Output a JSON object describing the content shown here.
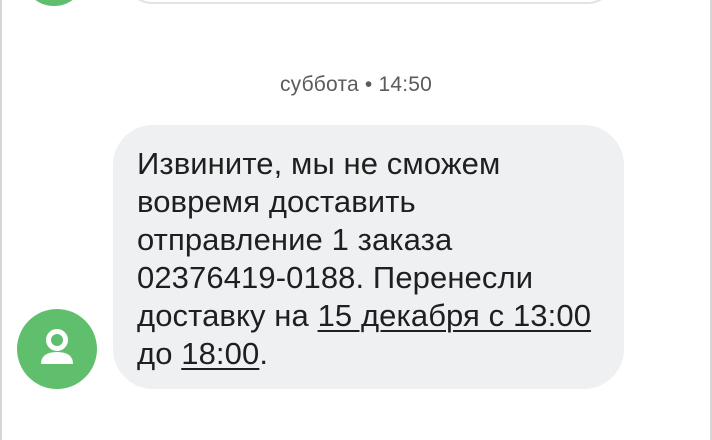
{
  "conversation": {
    "timestamp": {
      "day": "суббота",
      "separator": "•",
      "time": "14:50"
    },
    "message": {
      "part1": "Извините, мы не сможем вовремя доставить отправление 1 заказа 02376419-0188. Перенесли доставку на ",
      "link_date": "15 декабря с 13:00",
      "part2": " до ",
      "link_time": "18:00",
      "part3": "."
    },
    "sender_avatar": {
      "icon": "person-icon",
      "color": "#5fbf6d"
    },
    "bubble_color": "#eef0f2"
  }
}
